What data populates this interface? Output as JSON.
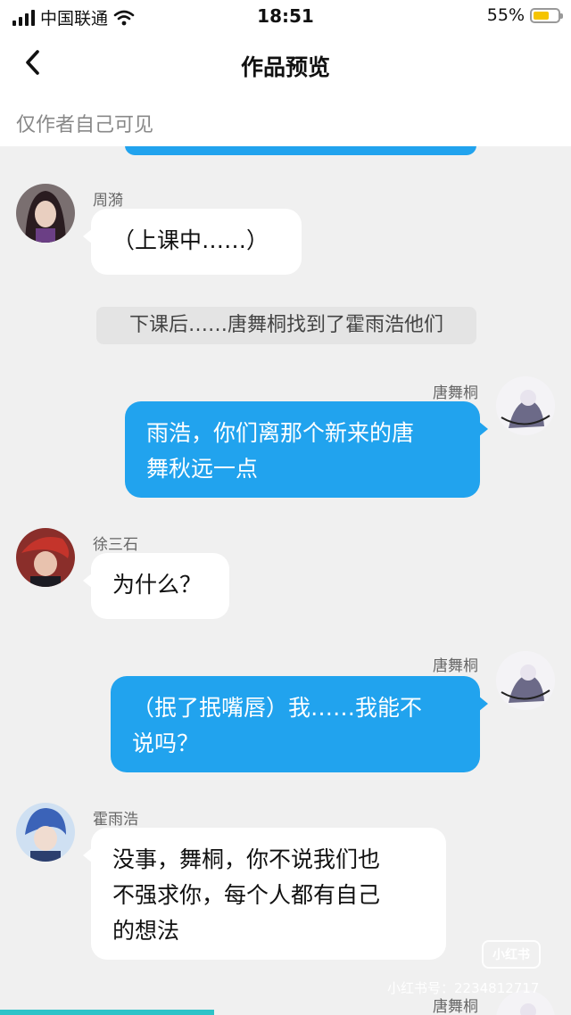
{
  "status_bar": {
    "carrier": "中国联通",
    "time": "18:51",
    "battery": "55%"
  },
  "nav": {
    "title": "作品预览"
  },
  "notice": {
    "text": "仅作者自己可见"
  },
  "messages": [
    {
      "side": "left",
      "sender": "周漪",
      "text": "（上课中……）"
    },
    {
      "side": "center",
      "text": "下课后……唐舞桐找到了霍雨浩他们"
    },
    {
      "side": "right",
      "sender": "唐舞桐",
      "lines": [
        "雨浩，你们离那个新来的唐",
        "舞秋远一点"
      ]
    },
    {
      "side": "left",
      "sender": "徐三石",
      "text": "为什么？"
    },
    {
      "side": "right",
      "sender": "唐舞桐",
      "lines": [
        "（抿了抿嘴唇）我……我能不",
        "说吗？"
      ]
    },
    {
      "side": "left",
      "sender": "霍雨浩",
      "lines": [
        "没事，舞桐，你不说我们也",
        "不强求你，每个人都有自己",
        "的想法"
      ]
    },
    {
      "side": "right",
      "sender": "唐舞桐",
      "text": ""
    }
  ],
  "watermark": {
    "logo": "小红书",
    "id": "小红书号：2234812717"
  },
  "colors": {
    "accent": "#21a3ee",
    "battery": "#f5c400",
    "background": "#f0f0f0"
  }
}
